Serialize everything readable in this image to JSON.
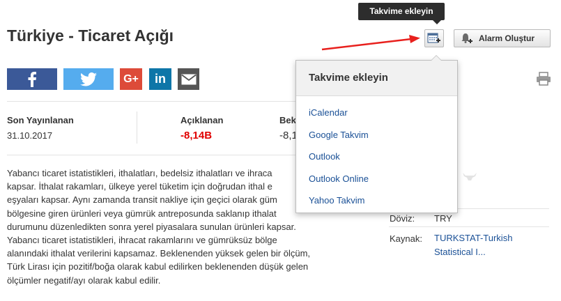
{
  "page": {
    "title": "Türkiye - Ticaret Açığı"
  },
  "tooltip": {
    "text": "Takvime ekleyin"
  },
  "buttons": {
    "alarm_label": "Alarm Oluştur"
  },
  "stats": {
    "published_label": "Son Yayınlanan",
    "published_value": "31.10.2017",
    "actual_label": "Açıklanan",
    "actual_value": "-8,14B",
    "expected_label": "Bek",
    "expected_value": "-8,1"
  },
  "description": {
    "p1_lines": [
      "Yabancı ticaret istatistikleri, ithalatları, bedelsiz ithalatları ve ihraca",
      "kapsar. İthalat rakamları, ülkeye yerel tüketim için doğrudan ithal e",
      "eşyaları kapsar. Aynı zamanda transit nakliye için geçici olarak güm",
      "bölgesine giren ürünleri veya gümrük antreposunda saklanıp ithalat",
      "durumunu düzenledikten sonra yerel piyasalara sunulan ürünleri kapsar."
    ],
    "p2_lines": [
      "Yabancı ticaret istatistikleri, ihracat rakamlarını ve gümrüksüz bölge",
      "alanındaki ithalat verilerini kapsamaz. Beklenenden yüksek gelen bir ölçüm,",
      "Türk Lirası için pozitif/boğa olarak kabul edilirken beklenenden düşük gelen",
      "ölçümler negatif/ayı olarak kabul edilir."
    ]
  },
  "info": {
    "currency_label": "Döviz:",
    "currency_value": "TRY",
    "source_label": "Kaynak:",
    "source_line1": "TURKSTAT-Turkish",
    "source_line2": "Statistical I..."
  },
  "dropdown": {
    "header": "Takvime ekleyin",
    "items": [
      "iCalendar",
      "Google Takvim",
      "Outlook",
      "Outlook Online",
      "Yahoo Takvim"
    ]
  },
  "colors": {
    "facebook": "#3b5998",
    "twitter": "#55acee",
    "googleplus": "#dd4b39",
    "linkedin": "#0e76a8",
    "email": "#555555",
    "negative": "#e00000",
    "link": "#1a5096",
    "annotation_arrow": "#e8201d"
  }
}
